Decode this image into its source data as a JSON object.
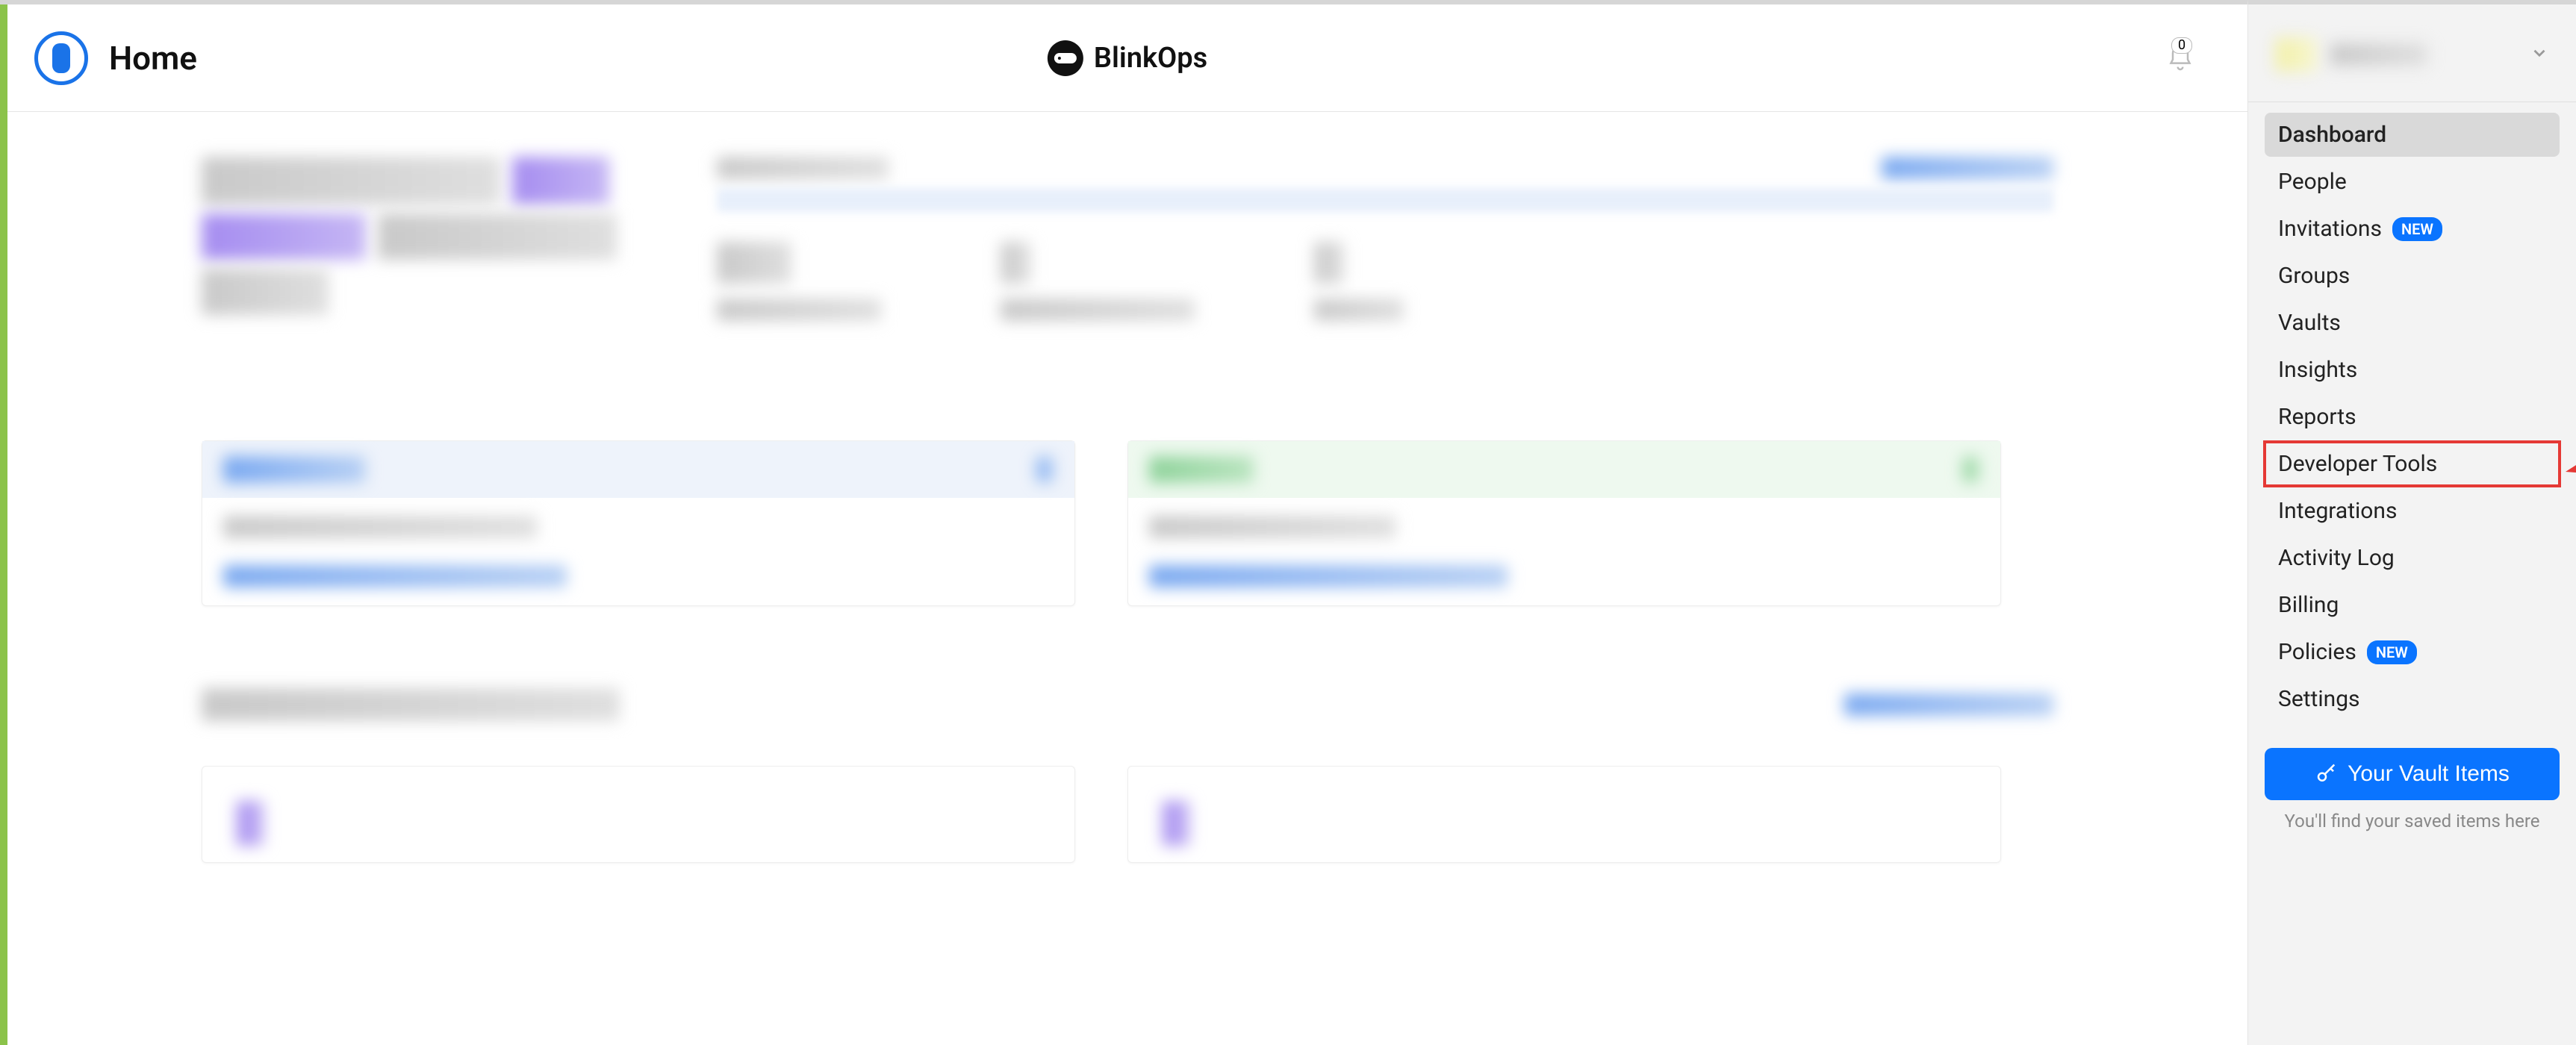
{
  "header": {
    "page_title": "Home",
    "brand_name": "BlinkOps",
    "notification_count": "0"
  },
  "sidebar": {
    "items": [
      {
        "label": "Dashboard",
        "active": true
      },
      {
        "label": "People",
        "active": false
      },
      {
        "label": "Invitations",
        "active": false,
        "badge": "NEW"
      },
      {
        "label": "Groups",
        "active": false
      },
      {
        "label": "Vaults",
        "active": false
      },
      {
        "label": "Insights",
        "active": false
      },
      {
        "label": "Reports",
        "active": false
      },
      {
        "label": "Developer Tools",
        "active": false,
        "highlighted": true
      },
      {
        "label": "Integrations",
        "active": false
      },
      {
        "label": "Activity Log",
        "active": false
      },
      {
        "label": "Billing",
        "active": false
      },
      {
        "label": "Policies",
        "active": false,
        "badge": "NEW"
      },
      {
        "label": "Settings",
        "active": false
      }
    ],
    "cta_label": "Your Vault Items",
    "cta_hint": "You'll find your saved items here"
  },
  "colors": {
    "accent_green": "#8bc34a",
    "primary_blue": "#0a74ff",
    "highlight_red": "#e53935"
  }
}
